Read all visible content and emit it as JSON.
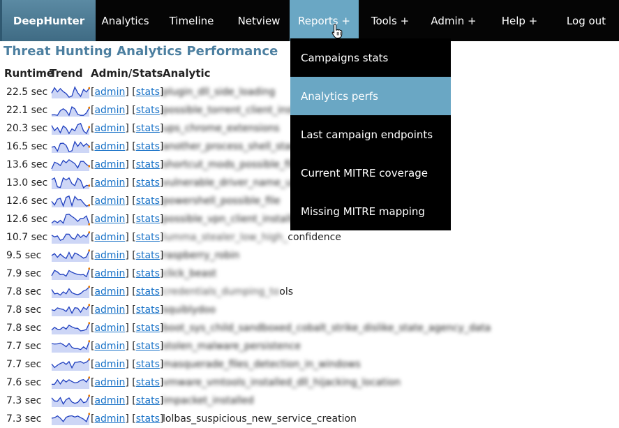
{
  "nav": {
    "brand": "DeepHunter",
    "items": [
      {
        "label": "Analytics"
      },
      {
        "label": "Timeline"
      },
      {
        "label": "Netview"
      },
      {
        "label": "Reports +"
      },
      {
        "label": "Tools +"
      },
      {
        "label": "Admin +"
      },
      {
        "label": "Help +"
      },
      {
        "label": "Log out"
      }
    ],
    "active_color": "#6aa7c4"
  },
  "reports_menu": {
    "items": [
      {
        "label": "Campaigns stats"
      },
      {
        "label": "Analytics perfs"
      },
      {
        "label": "Last campaign endpoints"
      },
      {
        "label": "Current MITRE coverage"
      },
      {
        "label": "Missing MITRE mapping"
      }
    ],
    "active_item": "Analytics perfs"
  },
  "page": {
    "title": "Threat Hunting Analytics Performance",
    "columns": {
      "runtime": "Runtime",
      "trend": "Trend",
      "admin_stats": "Admin/Stats",
      "analytic": "Analytic"
    }
  },
  "link_labels": {
    "admin": "admin",
    "stats": "stats"
  },
  "rows": [
    {
      "runtime": "22.5 sec",
      "name": "plugin_dll_side_loading",
      "blurred": true
    },
    {
      "runtime": "22.1 sec",
      "name": "possible_torrent_client_install",
      "blurred": true
    },
    {
      "runtime": "20.3 sec",
      "name": "ups_chrome_extensions",
      "blurred": true
    },
    {
      "runtime": "16.5 sec",
      "name": "another_process_shell_started",
      "blurred": true
    },
    {
      "runtime": "13.6 sec",
      "name": "shortcut_mods_possible_files",
      "blurred": true
    },
    {
      "runtime": "13.0 sec",
      "name": "vulnerable_driver_name_used",
      "blurred": true
    },
    {
      "runtime": "12.6 sec",
      "name": "powershell_possible_file",
      "blurred": true
    },
    {
      "runtime": "12.6 sec",
      "name": "possible_vpn_client_installer",
      "blurred": true
    },
    {
      "runtime": "10.7 sec",
      "name_blur": "lumma_stealer_low_high_",
      "name_tail": "confidence",
      "blurred": "partial"
    },
    {
      "runtime": "9.5 sec",
      "name": "raspberry_robin",
      "blurred": true
    },
    {
      "runtime": "7.9 sec",
      "name": "click_beast",
      "blurred": true
    },
    {
      "runtime": "7.8 sec",
      "name_blur": "credentials_dumping_to",
      "name_tail": "ols",
      "blurred": "partial"
    },
    {
      "runtime": "7.8 sec",
      "name": "squiblydoo",
      "blurred": true
    },
    {
      "runtime": "7.8 sec",
      "name": "boot_sys_child_sandboxed_cobalt_strike_dislike_state_agency_data",
      "blurred": true
    },
    {
      "runtime": "7.7 sec",
      "name": "stolen_malware_persistence",
      "blurred": true
    },
    {
      "runtime": "7.7 sec",
      "name": "masquerade_files_detection_in_windows",
      "blurred": true
    },
    {
      "runtime": "7.6 sec",
      "name": "vmware_vmtools_installed_dll_hijacking_location",
      "blurred": true
    },
    {
      "runtime": "7.3 sec",
      "name": "impacket_installed",
      "blurred": true
    },
    {
      "runtime": "7.3 sec",
      "name_blur": "",
      "name_tail": "lolbas_suspicious_new_service_creation",
      "blurred": "partial"
    }
  ],
  "trend_color": "#1f3fbf",
  "trend_fill": "#cdd6f6",
  "trend_last_point_color": "#e87a00"
}
